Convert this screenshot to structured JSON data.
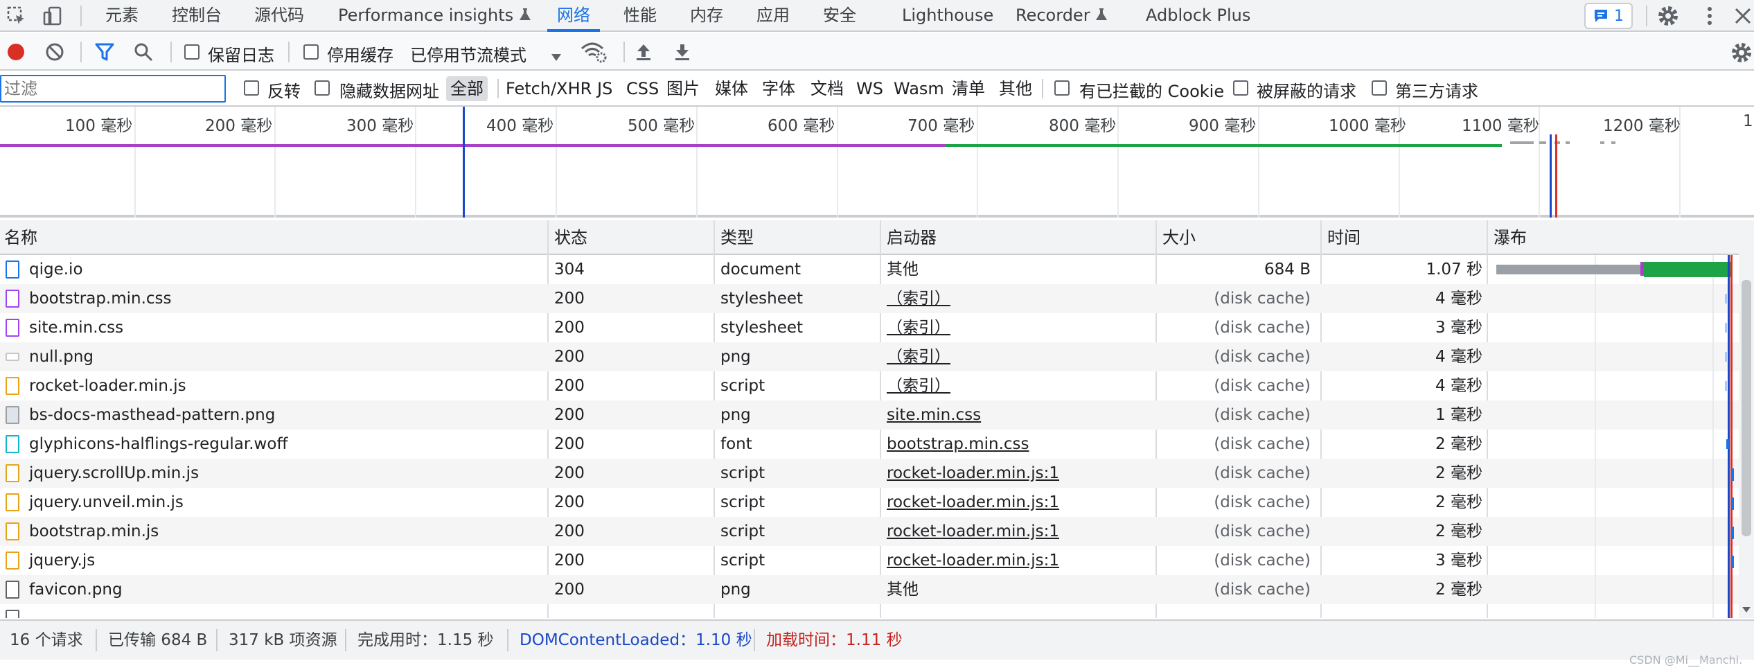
{
  "top_tabs": {
    "items": [
      {
        "label": "元素"
      },
      {
        "label": "控制台"
      },
      {
        "label": "源代码"
      },
      {
        "label": "Performance insights"
      },
      {
        "label": "网络"
      },
      {
        "label": "性能"
      },
      {
        "label": "内存"
      },
      {
        "label": "应用"
      },
      {
        "label": "安全"
      },
      {
        "label": "Lighthouse"
      },
      {
        "label": "Recorder"
      },
      {
        "label": "Adblock Plus"
      }
    ],
    "active": "网络",
    "issues_count": "1"
  },
  "toolbar": {
    "preserve_log": "保留日志",
    "disable_cache": "停用缓存",
    "throttling": "已停用节流模式"
  },
  "filter": {
    "placeholder": "过滤",
    "invert": "反转",
    "hide_data_urls": "隐藏数据网址",
    "types": [
      "全部",
      "Fetch/XHR",
      "JS",
      "CSS",
      "图片",
      "媒体",
      "字体",
      "文档",
      "WS",
      "Wasm",
      "清单",
      "其他"
    ],
    "blocked_cookies": "有已拦截的 Cookie",
    "blocked_requests": "被屏蔽的请求",
    "third_party": "第三方请求"
  },
  "overview": {
    "ticks": [
      "100 毫秒",
      "200 毫秒",
      "300 毫秒",
      "400 毫秒",
      "500 毫秒",
      "600 毫秒",
      "700 毫秒",
      "800 毫秒",
      "900 毫秒",
      "1000 毫秒",
      "1100 毫秒",
      "1200 毫秒",
      "1"
    ]
  },
  "table": {
    "headers": {
      "name": "名称",
      "status": "状态",
      "type": "类型",
      "initiator": "启动器",
      "size": "大小",
      "time": "时间",
      "waterfall": "瀑布"
    },
    "rows": [
      {
        "name": "qige.io",
        "status": "304",
        "type": "document",
        "initiator": "其他",
        "size": "684 B",
        "time": "1.07 秒"
      },
      {
        "name": "bootstrap.min.css",
        "status": "200",
        "type": "stylesheet",
        "initiator": "（索引）",
        "size": "(disk cache)",
        "time": "4 毫秒"
      },
      {
        "name": "site.min.css",
        "status": "200",
        "type": "stylesheet",
        "initiator": "（索引）",
        "size": "(disk cache)",
        "time": "3 毫秒"
      },
      {
        "name": "null.png",
        "status": "200",
        "type": "png",
        "initiator": "（索引）",
        "size": "(disk cache)",
        "time": "4 毫秒"
      },
      {
        "name": "rocket-loader.min.js",
        "status": "200",
        "type": "script",
        "initiator": "（索引）",
        "size": "(disk cache)",
        "time": "4 毫秒"
      },
      {
        "name": "bs-docs-masthead-pattern.png",
        "status": "200",
        "type": "png",
        "initiator": "site.min.css",
        "size": "(disk cache)",
        "time": "1 毫秒"
      },
      {
        "name": "glyphicons-halflings-regular.woff",
        "status": "200",
        "type": "font",
        "initiator": "bootstrap.min.css",
        "size": "(disk cache)",
        "time": "2 毫秒"
      },
      {
        "name": "jquery.scrollUp.min.js",
        "status": "200",
        "type": "script",
        "initiator": "rocket-loader.min.js:1",
        "size": "(disk cache)",
        "time": "2 毫秒"
      },
      {
        "name": "jquery.unveil.min.js",
        "status": "200",
        "type": "script",
        "initiator": "rocket-loader.min.js:1",
        "size": "(disk cache)",
        "time": "2 毫秒"
      },
      {
        "name": "bootstrap.min.js",
        "status": "200",
        "type": "script",
        "initiator": "rocket-loader.min.js:1",
        "size": "(disk cache)",
        "time": "2 毫秒"
      },
      {
        "name": "jquery.js",
        "status": "200",
        "type": "script",
        "initiator": "rocket-loader.min.js:1",
        "size": "(disk cache)",
        "time": "3 毫秒"
      },
      {
        "name": "favicon.png",
        "status": "200",
        "type": "png",
        "initiator": "其他",
        "size": "(disk cache)",
        "time": "2 毫秒"
      }
    ]
  },
  "status_bar": {
    "requests": "16 个请求",
    "transferred": "已传输 684 B",
    "resources": "317 kB 项资源",
    "finish": "完成用时：1.15 秒",
    "dcl": "DOMContentLoaded：1.10 秒",
    "load": "加载时间：1.11 秒"
  },
  "watermark": "CSDN @Mi__Manchi."
}
